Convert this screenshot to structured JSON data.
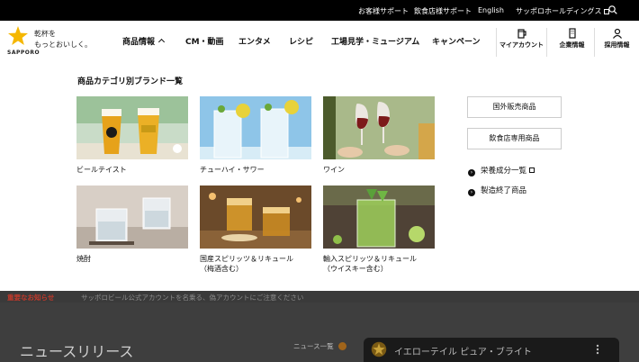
{
  "topbar": {
    "customer_support": "お客様サポート",
    "restaurant_support": "飲食店様サポート",
    "english": "English",
    "holdings": "サッポロホールディングス"
  },
  "logo": {
    "wordmark": "SAPPORO",
    "tagline_line1": "乾杯を",
    "tagline_line2": "もっとおいしく。"
  },
  "nav": {
    "products": "商品情報",
    "cm_video": "CM・動画",
    "entertainment": "エンタメ",
    "recipe": "レシピ",
    "factory_tour": "工場見学・ミュージアム",
    "campaign": "キャンペーン"
  },
  "util": {
    "my_account": "マイアカウント",
    "company": "企業情報",
    "recruit": "採用情報"
  },
  "mega": {
    "title": "商品カテゴリ別ブランド一覧",
    "categories": [
      {
        "label": "ビールテイスト"
      },
      {
        "label": "チューハイ・サワー"
      },
      {
        "label": "ワイン"
      },
      {
        "label": "焼酎"
      },
      {
        "label": "国産スピリッツ＆リキュール",
        "label2": "（梅酒含む）"
      },
      {
        "label": "輸入スピリッツ＆リキュール",
        "label2": "（ウイスキー含む）"
      }
    ],
    "side_buttons": [
      "国外販売商品",
      "飲食店専用商品"
    ],
    "side_links": [
      "栄養成分一覧",
      "製造終了商品"
    ]
  },
  "background": {
    "notice_label": "重要なお知らせ",
    "notice_text": "サッポロビール公式アカウントを名乗る、偽アカウントにご注意ください",
    "news_title": "ニュースリリース",
    "news_link": "ニュース一覧",
    "video_title": "イエローテイル ピュア・ブライト"
  },
  "colors": {
    "topbar": "#000000",
    "star": "#f5b700",
    "overlay": "#3e3e3e",
    "notice": "#c0392b"
  }
}
